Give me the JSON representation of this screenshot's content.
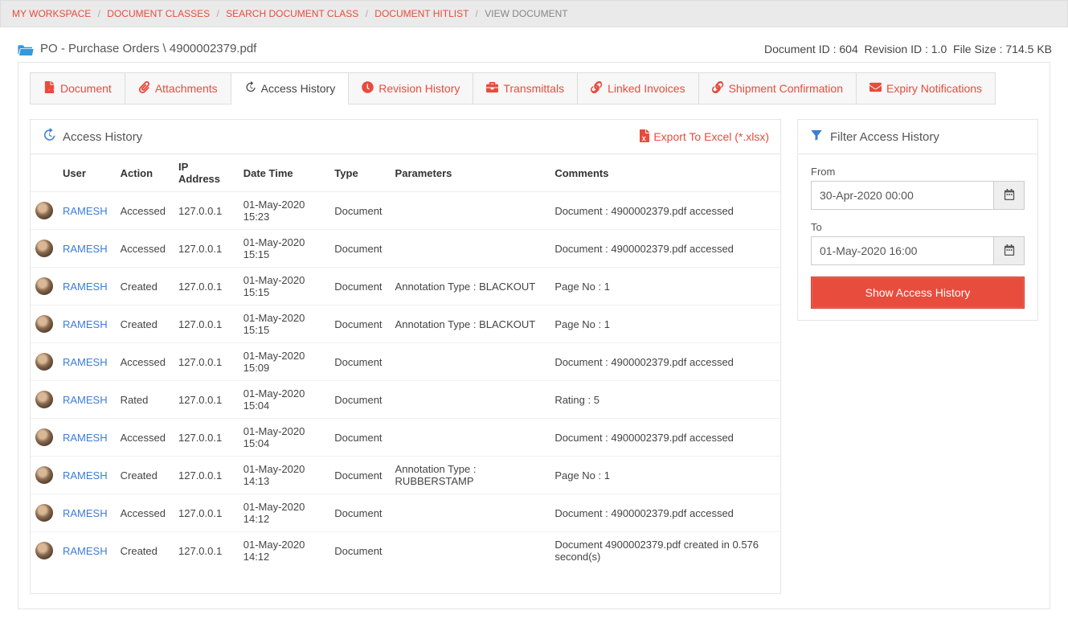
{
  "breadcrumb": {
    "items": [
      "MY WORKSPACE",
      "DOCUMENT CLASSES",
      "SEARCH DOCUMENT CLASS",
      "DOCUMENT HITLIST"
    ],
    "current": "VIEW DOCUMENT"
  },
  "title": "PO - Purchase Orders \\ 4900002379.pdf",
  "meta": {
    "docid_label": "Document ID :",
    "docid": "604",
    "revid_label": "Revision ID :",
    "revid": "1.0",
    "filesize_label": "File Size :",
    "filesize": "714.5 KB"
  },
  "tabs": [
    {
      "label": "Document",
      "icon": "file-pdf"
    },
    {
      "label": "Attachments",
      "icon": "paperclip"
    },
    {
      "label": "Access History",
      "icon": "history"
    },
    {
      "label": "Revision History",
      "icon": "clock"
    },
    {
      "label": "Transmittals",
      "icon": "briefcase"
    },
    {
      "label": "Linked Invoices",
      "icon": "link"
    },
    {
      "label": "Shipment Confirmation",
      "icon": "link"
    },
    {
      "label": "Expiry Notifications",
      "icon": "envelope"
    }
  ],
  "activeTab": 2,
  "historyPanel": {
    "title": "Access History",
    "exportLabel": "Export To Excel (*.xlsx)",
    "columns": [
      "",
      "User",
      "Action",
      "IP Address",
      "Date Time",
      "Type",
      "Parameters",
      "Comments"
    ],
    "rows": [
      {
        "user": "RAMESH",
        "action": "Accessed",
        "ip": "127.0.0.1",
        "dt": "01-May-2020 15:23",
        "type": "Document",
        "params": "",
        "comments": "Document : 4900002379.pdf accessed"
      },
      {
        "user": "RAMESH",
        "action": "Accessed",
        "ip": "127.0.0.1",
        "dt": "01-May-2020 15:15",
        "type": "Document",
        "params": "",
        "comments": "Document : 4900002379.pdf accessed"
      },
      {
        "user": "RAMESH",
        "action": "Created",
        "ip": "127.0.0.1",
        "dt": "01-May-2020 15:15",
        "type": "Document",
        "params": "Annotation Type : BLACKOUT",
        "comments": "Page No : 1"
      },
      {
        "user": "RAMESH",
        "action": "Created",
        "ip": "127.0.0.1",
        "dt": "01-May-2020 15:15",
        "type": "Document",
        "params": "Annotation Type : BLACKOUT",
        "comments": "Page No : 1"
      },
      {
        "user": "RAMESH",
        "action": "Accessed",
        "ip": "127.0.0.1",
        "dt": "01-May-2020 15:09",
        "type": "Document",
        "params": "",
        "comments": "Document : 4900002379.pdf accessed"
      },
      {
        "user": "RAMESH",
        "action": "Rated",
        "ip": "127.0.0.1",
        "dt": "01-May-2020 15:04",
        "type": "Document",
        "params": "",
        "comments": "Rating : 5"
      },
      {
        "user": "RAMESH",
        "action": "Accessed",
        "ip": "127.0.0.1",
        "dt": "01-May-2020 15:04",
        "type": "Document",
        "params": "",
        "comments": "Document : 4900002379.pdf accessed"
      },
      {
        "user": "RAMESH",
        "action": "Created",
        "ip": "127.0.0.1",
        "dt": "01-May-2020 14:13",
        "type": "Document",
        "params": "Annotation Type : RUBBERSTAMP",
        "comments": "Page No : 1"
      },
      {
        "user": "RAMESH",
        "action": "Accessed",
        "ip": "127.0.0.1",
        "dt": "01-May-2020 14:12",
        "type": "Document",
        "params": "",
        "comments": "Document : 4900002379.pdf accessed"
      },
      {
        "user": "RAMESH",
        "action": "Created",
        "ip": "127.0.0.1",
        "dt": "01-May-2020 14:12",
        "type": "Document",
        "params": "",
        "comments": "Document 4900002379.pdf created in 0.576 second(s)"
      }
    ]
  },
  "filter": {
    "title": "Filter Access History",
    "fromLabel": "From",
    "fromValue": "30-Apr-2020 00:00",
    "toLabel": "To",
    "toValue": "01-May-2020 16:00",
    "buttonLabel": "Show Access History"
  }
}
